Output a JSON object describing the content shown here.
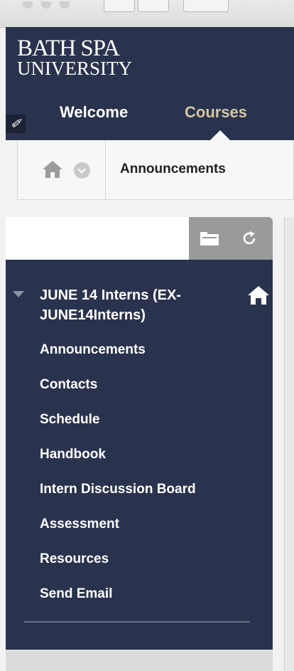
{
  "header": {
    "logo_line1": "BATH SPA",
    "logo_line2": "UNIVERSITY",
    "tabs": [
      {
        "label": "Welcome",
        "active": false
      },
      {
        "label": "Courses",
        "active": true
      }
    ],
    "colors": {
      "navy": "#2a334d",
      "active_tab": "#d4c7a6"
    }
  },
  "breadcrumb": {
    "current": "Announcements"
  },
  "course_menu": {
    "course_title": "JUNE 14 Interns (EX-JUNE14Interns)",
    "items": [
      {
        "label": "Announcements"
      },
      {
        "label": "Contacts"
      },
      {
        "label": "Schedule"
      },
      {
        "label": "Handbook"
      },
      {
        "label": "Intern Discussion Board"
      },
      {
        "label": "Assessment"
      },
      {
        "label": "Resources"
      },
      {
        "label": "Send Email"
      }
    ]
  },
  "icons": [
    "edit-mode-icon",
    "home-icon",
    "chevron-down-icon",
    "folder-view-icon",
    "refresh-icon",
    "collapse-arrow-icon",
    "course-home-icon"
  ]
}
